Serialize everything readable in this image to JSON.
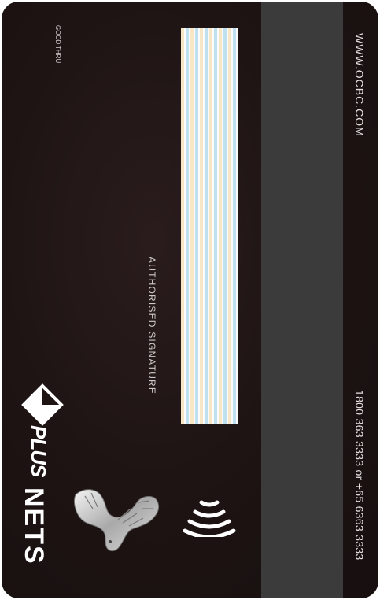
{
  "card": {
    "website": "WWW.OCBC.COM",
    "phone": "1800 363 3333 or +65 6363 3333",
    "signature_label": "AUTHORISED SIGNATURE",
    "good_thru_line1": "GOOD",
    "good_thru_line2": "THRU",
    "plus_logo_text": "PLUS",
    "nets_logo_text": "NETS"
  },
  "icons": {
    "plus": "plus-network-logo",
    "nets": "nets-logo",
    "bird": "bird-hologram-icon",
    "contactless": "contactless-icon"
  },
  "colors": {
    "card_background": "#1d1313",
    "magnetic_stripe": "#3b3b3b",
    "text": "#e6e2e2"
  }
}
